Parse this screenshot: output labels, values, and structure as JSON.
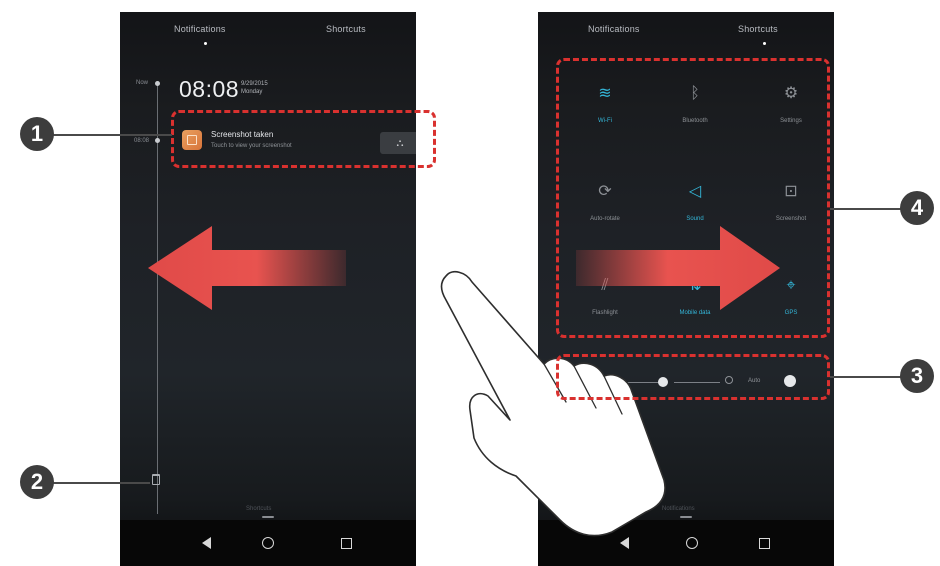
{
  "tabs": {
    "notifications": "Notifications",
    "shortcuts": "Shortcuts"
  },
  "left_phone": {
    "timeline_now": "Now",
    "timeline_entry": "08:08",
    "clock_time": "08:08",
    "clock_date": "9/29/2015",
    "clock_day": "Monday",
    "notification_title": "Screenshot taken",
    "notification_subtitle": "Touch to view your screenshot",
    "share_glyph": "⛬",
    "handle_label": "Shortcuts"
  },
  "right_phone": {
    "toggles": [
      {
        "label": "Wi-Fi",
        "icon": "wifi-icon",
        "glyph": "≋",
        "active": true
      },
      {
        "label": "Bluetooth",
        "icon": "bluetooth-icon",
        "glyph": "ᛒ",
        "active": false
      },
      {
        "label": "Settings",
        "icon": "gear-icon",
        "glyph": "⚙",
        "active": false
      },
      {
        "label": "Auto-rotate",
        "icon": "rotate-icon",
        "glyph": "⟳",
        "active": false
      },
      {
        "label": "Sound",
        "icon": "speaker-icon",
        "glyph": "◁",
        "active": true
      },
      {
        "label": "Screenshot",
        "icon": "screenshot-icon",
        "glyph": "⊡",
        "active": false
      },
      {
        "label": "Flashlight",
        "icon": "flashlight-icon",
        "glyph": "⫽",
        "active": false
      },
      {
        "label": "Mobile data",
        "icon": "mobile-data-icon",
        "glyph": "⇅",
        "active": true
      },
      {
        "label": "GPS",
        "icon": "location-pin-icon",
        "glyph": "⌖",
        "active": true
      }
    ],
    "brightness_auto_label": "Auto",
    "handle_label": "Notifications"
  },
  "callouts": {
    "c1": "1",
    "c2": "2",
    "c3": "3",
    "c4": "4"
  },
  "colors": {
    "annotation_red": "#d9312f",
    "active_toggle": "#34b6d8",
    "inactive_toggle": "#8d9196"
  }
}
